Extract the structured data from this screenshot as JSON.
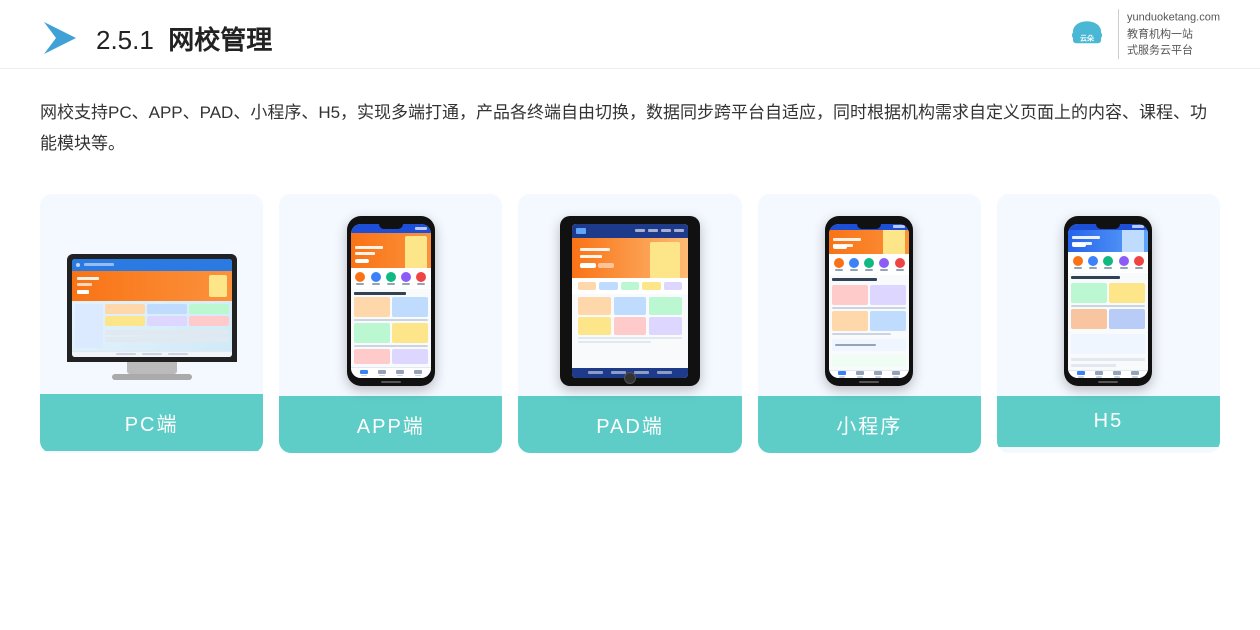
{
  "header": {
    "section_number": "2.5.1",
    "title": "网校管理",
    "brand_name": "云朵课堂",
    "brand_url": "yunduoketang.com",
    "brand_tagline": "教育机构一站\n式服务云平台"
  },
  "description": {
    "text": "网校支持PC、APP、PAD、小程序、H5，实现多端打通，产品各终端自由切换，数据同步跨平台自适应，同时根据机构需求自定义页面上的内容、课程、功能模块等。"
  },
  "cards": [
    {
      "id": "pc",
      "label": "PC端",
      "device_type": "monitor"
    },
    {
      "id": "app",
      "label": "APP端",
      "device_type": "phone"
    },
    {
      "id": "pad",
      "label": "PAD端",
      "device_type": "tablet"
    },
    {
      "id": "miniprogram",
      "label": "小程序",
      "device_type": "phone"
    },
    {
      "id": "h5",
      "label": "H5",
      "device_type": "phone"
    }
  ],
  "colors": {
    "teal": "#5ecdc8",
    "accent": "#f97316",
    "dark": "#222",
    "light_bg": "#f0f6ff"
  }
}
